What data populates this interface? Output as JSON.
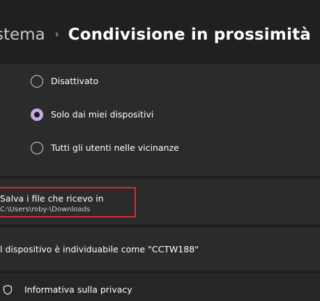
{
  "header": {
    "parent_crumb": "stema",
    "separator": "›",
    "current_page": "Condivisione in prossimità"
  },
  "sharing_options": {
    "items": [
      {
        "label": "Disattivato",
        "selected": false
      },
      {
        "label": "Solo dai miei dispositivi",
        "selected": true
      },
      {
        "label": "Tutti gli utenti nelle vicinanze",
        "selected": false
      }
    ]
  },
  "save_location": {
    "title": "Salva i file che ricevo in",
    "path": "C:\\Users\\roby-\\Downloads"
  },
  "device_discovery": {
    "text": "l dispositivo è individuabile come \"CCTW188\""
  },
  "privacy": {
    "link": "Informativa sulla privacy",
    "icon": "shield-icon"
  },
  "colors": {
    "accent": "#c7a6e6",
    "highlight_border": "#e0262e",
    "background": "#1f1f1f",
    "card": "#2b2b2b"
  }
}
